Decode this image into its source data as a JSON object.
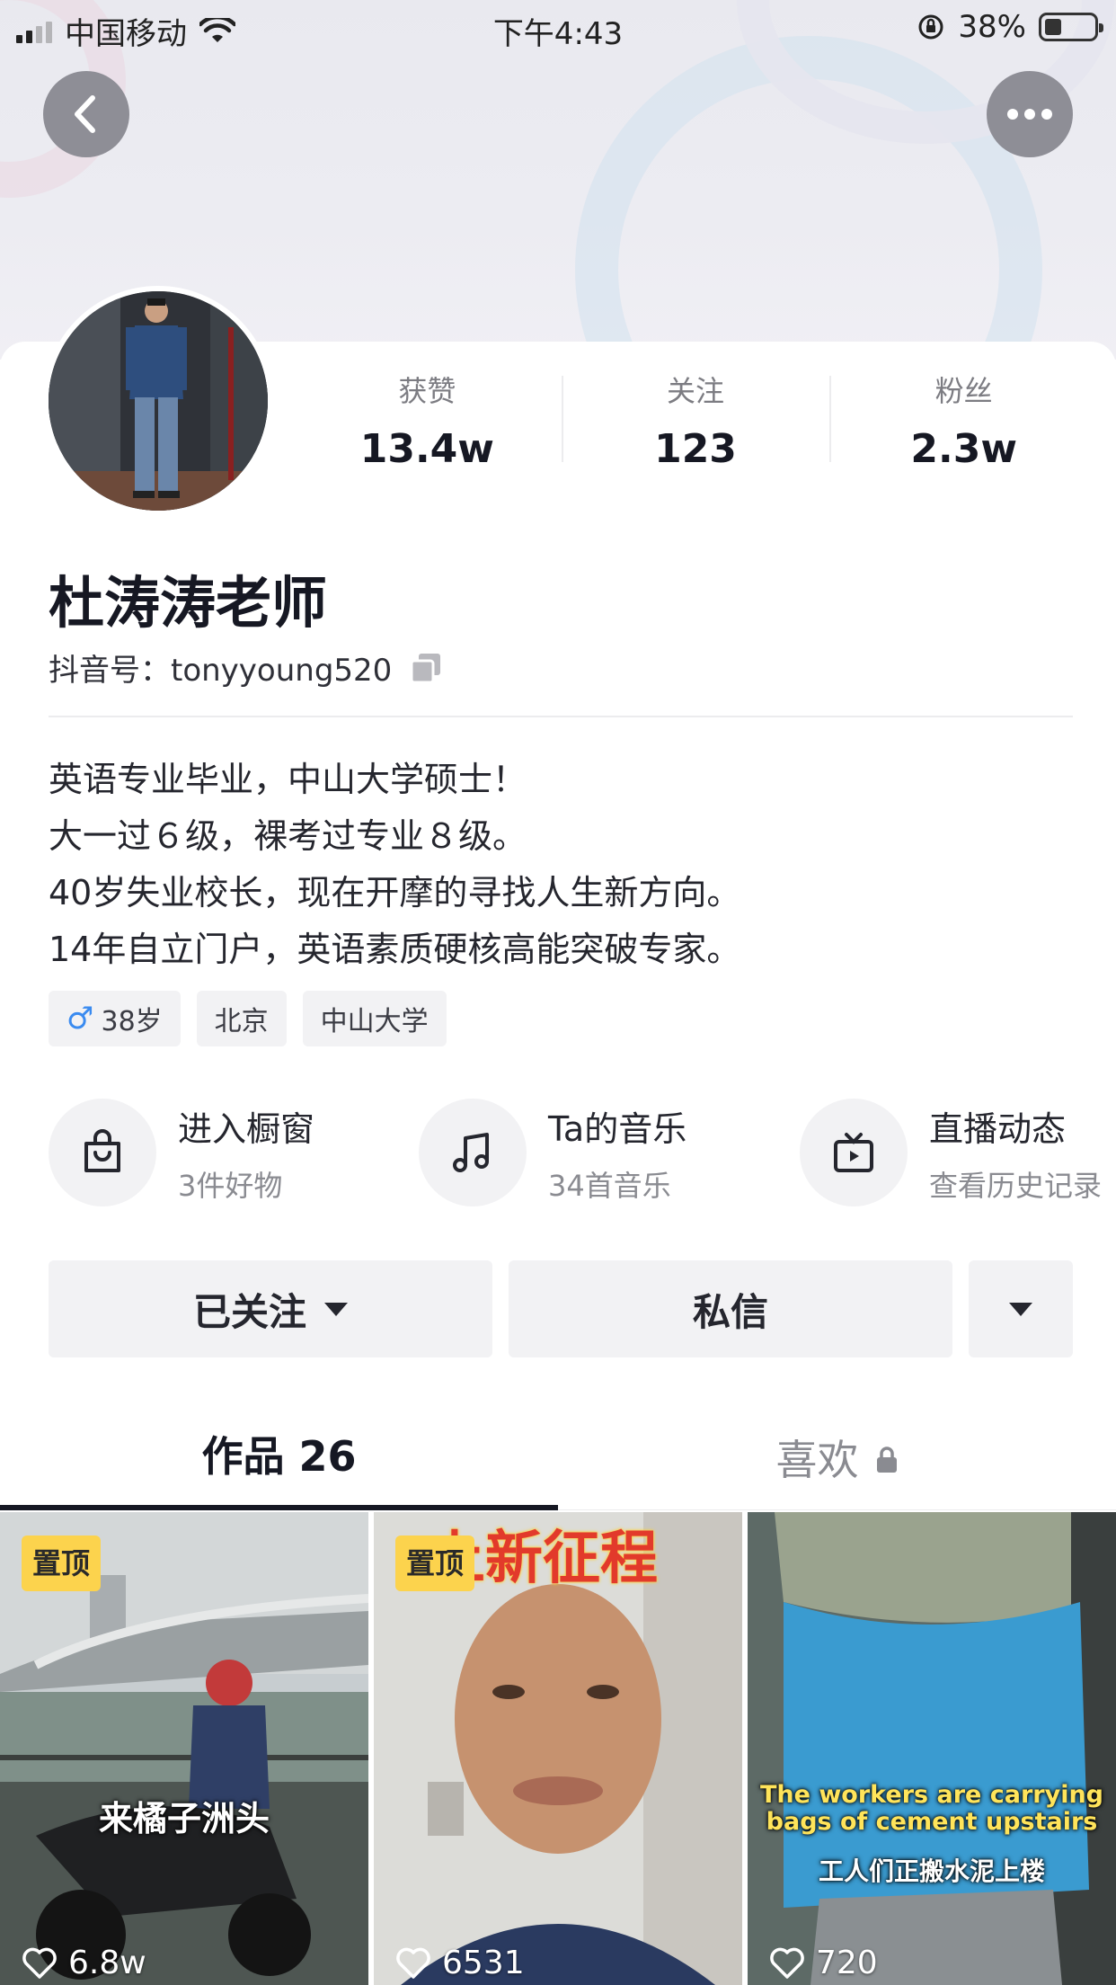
{
  "status_bar": {
    "carrier": "中国移动",
    "time": "下午4:43",
    "battery": "38%"
  },
  "profile": {
    "stats": [
      {
        "label": "获赞",
        "value": "13.4w"
      },
      {
        "label": "关注",
        "value": "123"
      },
      {
        "label": "粉丝",
        "value": "2.3w"
      }
    ],
    "name": "杜涛涛老师",
    "douyin_id": "抖音号：tonyyoung520",
    "bio": [
      "英语专业毕业，中山大学硕士！",
      "大一过６级，裸考过专业８级。",
      "40岁失业校长，现在开摩的寻找人生新方向。",
      "14年自立门户，英语素质硬核高能突破专家。"
    ],
    "tags": [
      {
        "label": "38岁",
        "icon": "male-icon"
      },
      {
        "label": "北京"
      },
      {
        "label": "中山大学"
      }
    ]
  },
  "entries": [
    {
      "title": "进入橱窗",
      "subtitle": "3件好物",
      "icon": "shopping-bag-icon"
    },
    {
      "title": "Ta的音乐",
      "subtitle": "34首音乐",
      "icon": "music-note-icon"
    },
    {
      "title": "直播动态",
      "subtitle": "查看历史记录",
      "icon": "tv-icon"
    }
  ],
  "actions": {
    "follow_label": "已关注",
    "message_label": "私信"
  },
  "tabs": {
    "works": "作品 26",
    "likes": "喜欢"
  },
  "videos": [
    {
      "pinned": "置顶",
      "likes": "6.8w",
      "overlay": "来橘子洲头"
    },
    {
      "pinned": "置顶",
      "likes": "6531",
      "overlay": "上新征程"
    },
    {
      "likes": "720",
      "overlay_en": "The workers are carrying bags of cement upstairs",
      "overlay_cn": "工人们正搬水泥上楼"
    }
  ]
}
